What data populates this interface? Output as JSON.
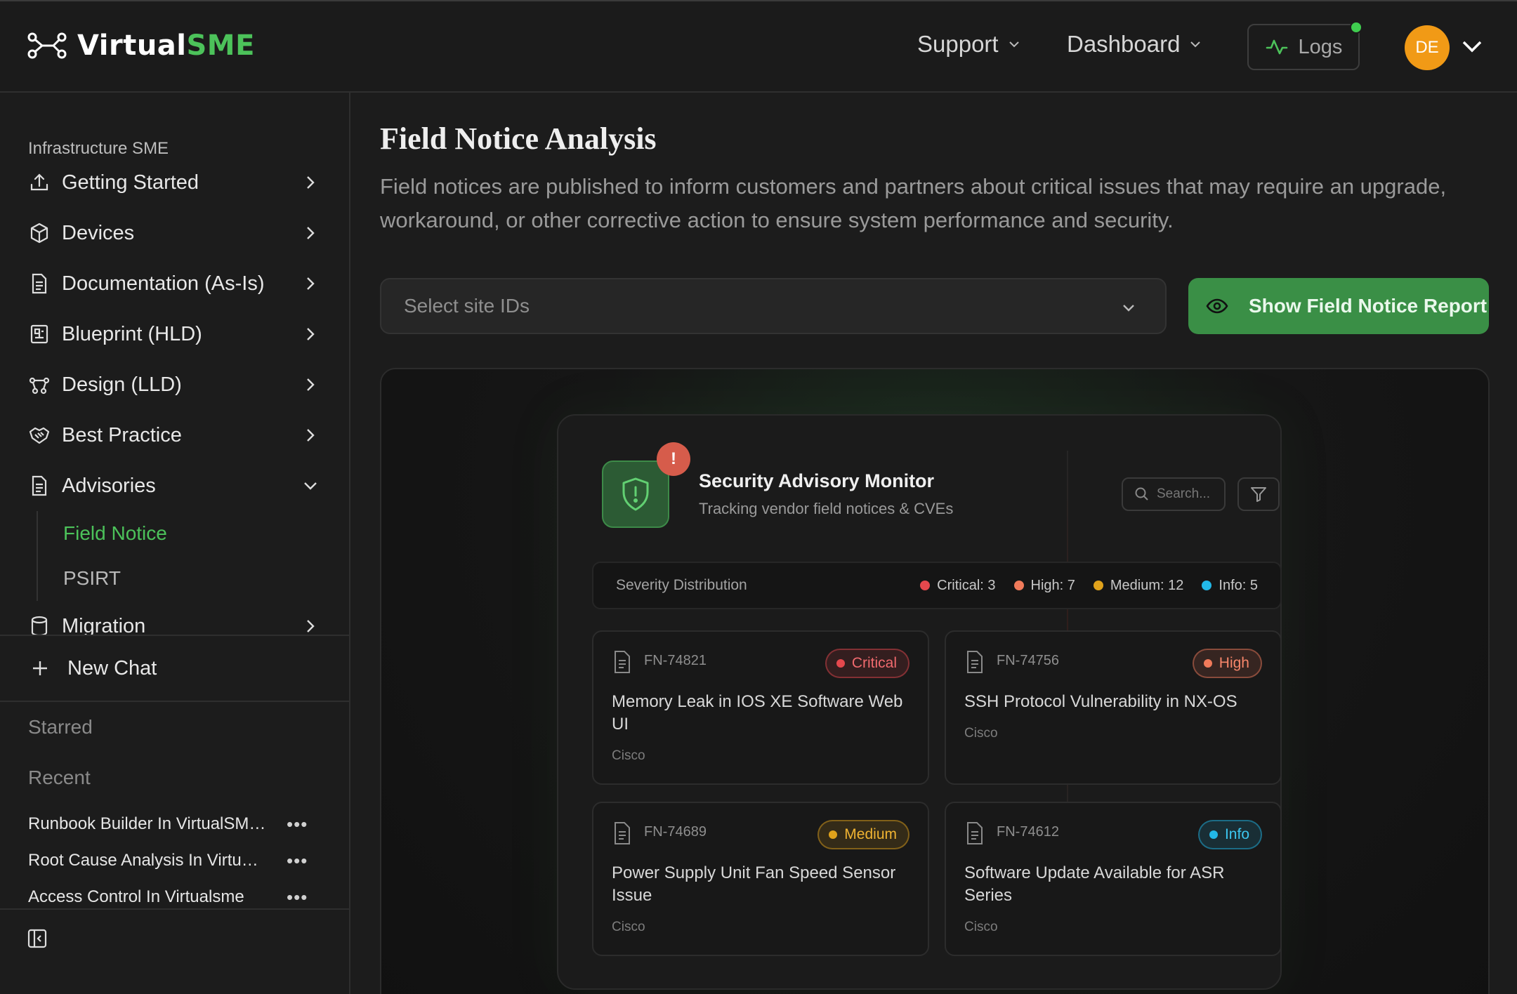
{
  "app": {
    "brand_prefix": "Virtual",
    "brand_suffix": "SME"
  },
  "header": {
    "support_label": "Support",
    "dashboard_label": "Dashboard",
    "logs_label": "Logs",
    "avatar_initials": "DE"
  },
  "sidebar": {
    "section_title": "Infrastructure SME",
    "items": [
      {
        "label": "Getting Started",
        "icon": "upload-icon"
      },
      {
        "label": "Devices",
        "icon": "cube-icon"
      },
      {
        "label": "Documentation (As-Is)",
        "icon": "document-icon"
      },
      {
        "label": "Blueprint (HLD)",
        "icon": "blueprint-icon"
      },
      {
        "label": "Design (LLD)",
        "icon": "network-icon"
      },
      {
        "label": "Best Practice",
        "icon": "handshake-icon"
      },
      {
        "label": "Advisories",
        "icon": "document-icon"
      }
    ],
    "advisories_sub": [
      {
        "label": "Field Notice",
        "active": true
      },
      {
        "label": "PSIRT",
        "active": false
      }
    ],
    "partial_item_label": "Migration",
    "new_chat_label": "New Chat",
    "starred_label": "Starred",
    "recent_label": "Recent",
    "recent_items": [
      "Runbook Builder In VirtualSME...",
      "Root Cause Analysis In Virtual...",
      "Access Control In Virtualsme"
    ],
    "more_glyph": "•••"
  },
  "main": {
    "title": "Field Notice Analysis",
    "description": "Field notices are published to inform customers and partners about critical issues that may require an upgrade, workaround, or other corrective action to ensure system performance and security.",
    "site_select_placeholder": "Select site IDs",
    "report_button_label": "Show Field Notice Report"
  },
  "monitor": {
    "title": "Security Advisory Monitor",
    "subtitle": "Tracking vendor field notices & CVEs",
    "alert_glyph": "!",
    "search_placeholder": "Search...",
    "severity_label": "Severity Distribution",
    "severity": [
      {
        "label": "Critical: 3",
        "color": "#e5484d"
      },
      {
        "label": "High: 7",
        "color": "#f07a5a"
      },
      {
        "label": "Medium: 12",
        "color": "#e0a21b"
      },
      {
        "label": "Info: 5",
        "color": "#22b8e8"
      }
    ],
    "notices": [
      {
        "id": "FN-74821",
        "badge": "Critical",
        "badge_color": "#e5484d",
        "title": "Memory Leak in IOS XE Software Web UI",
        "vendor": "Cisco"
      },
      {
        "id": "FN-74756",
        "badge": "High",
        "badge_color": "#f07a5a",
        "title": "SSH Protocol Vulnerability in NX-OS",
        "vendor": "Cisco"
      },
      {
        "id": "FN-74689",
        "badge": "Medium",
        "badge_color": "#e0a21b",
        "title": "Power Supply Unit Fan Speed Sensor Issue",
        "vendor": "Cisco"
      },
      {
        "id": "FN-74612",
        "badge": "Info",
        "badge_color": "#22b8e8",
        "title": "Software Update Available for ASR Series",
        "vendor": "Cisco"
      }
    ]
  },
  "colors": {
    "accent": "#4cc25a",
    "button": "#3a8f46",
    "avatar": "#f19a16"
  }
}
